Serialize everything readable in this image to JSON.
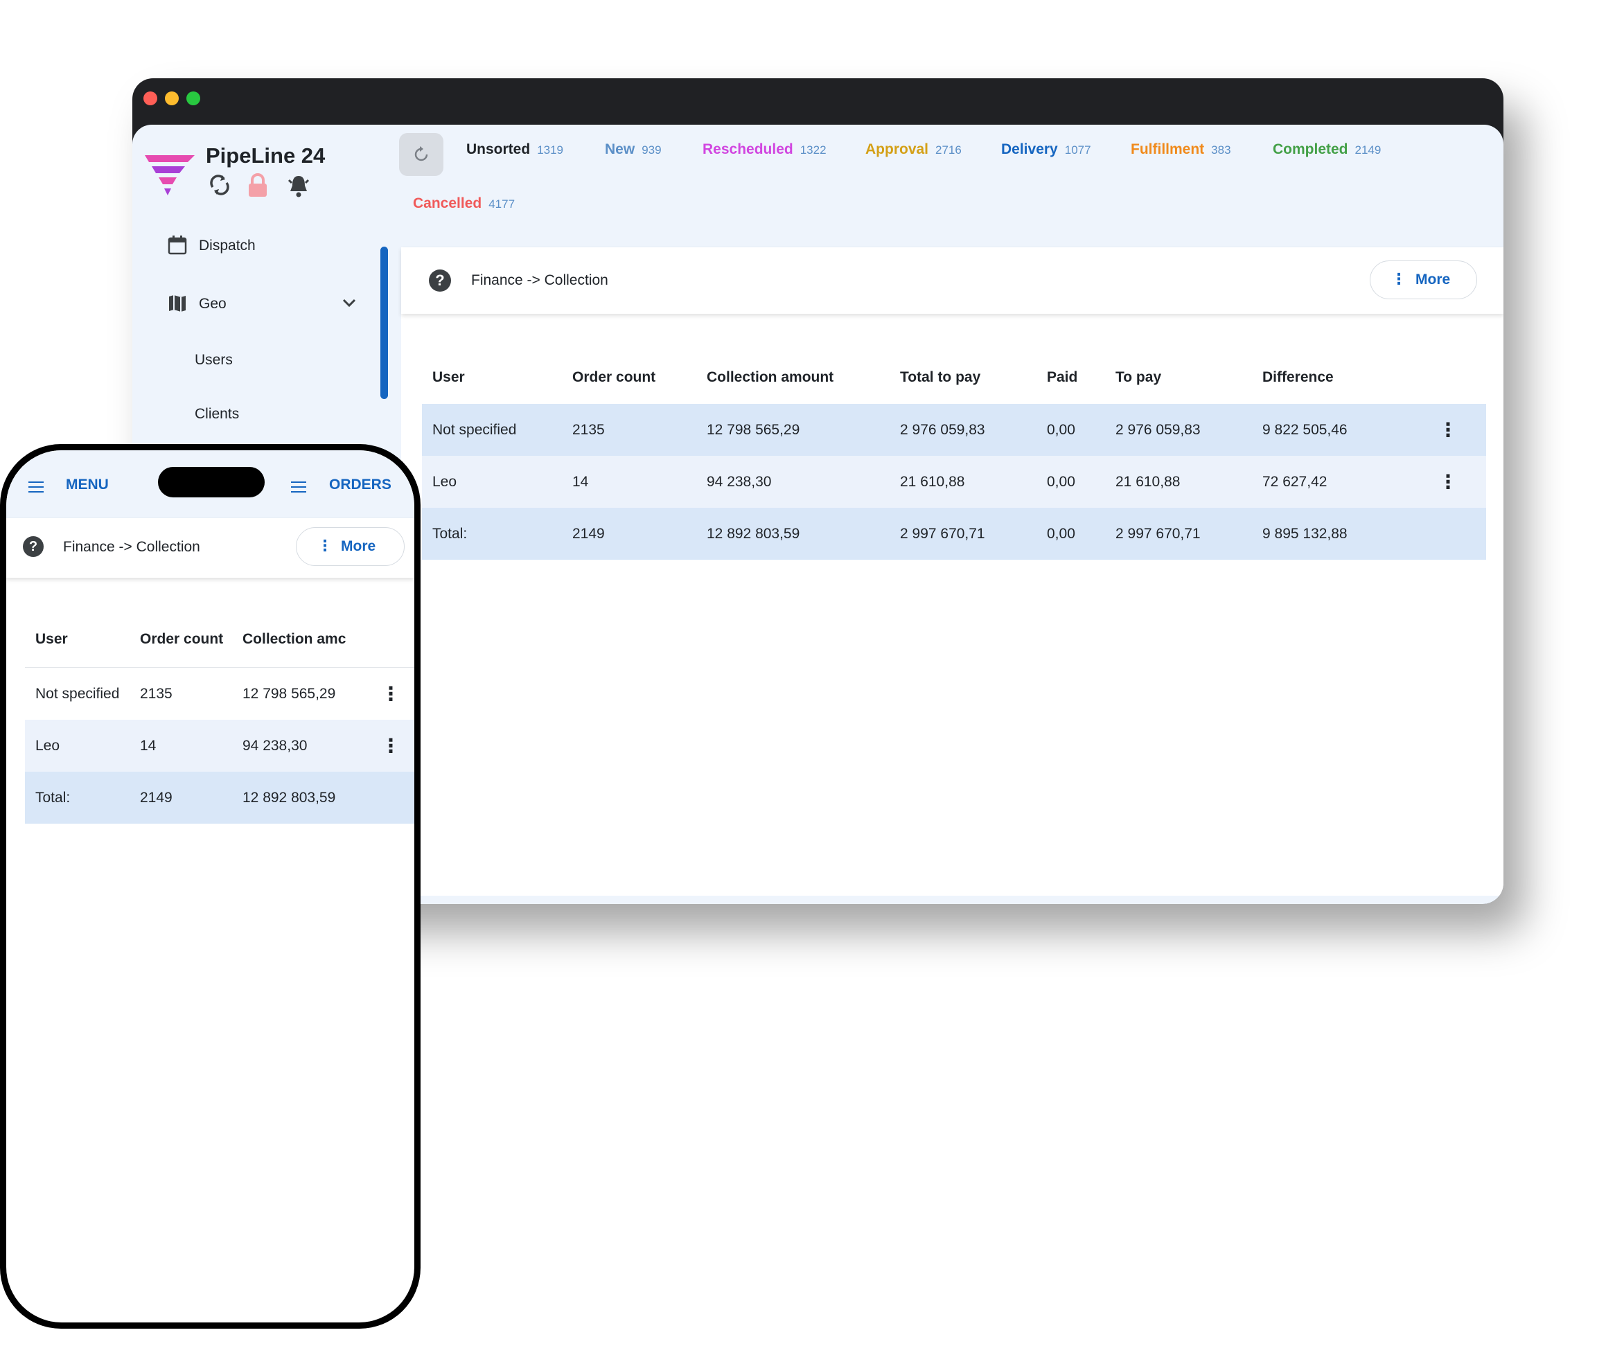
{
  "app": {
    "brand": "PipeLine 24",
    "sidebar": [
      {
        "label": "Dispatch",
        "icon": "calendar-icon"
      },
      {
        "label": "Geo",
        "icon": "map-icon"
      },
      {
        "label": "Users"
      },
      {
        "label": "Clients"
      }
    ],
    "status_chips": [
      {
        "label": "Unsorted",
        "count": "1319",
        "color": "#1f2328"
      },
      {
        "label": "New",
        "count": "939",
        "color": "#5b8fc7"
      },
      {
        "label": "Rescheduled",
        "count": "1322",
        "color": "#d146e0"
      },
      {
        "label": "Approval",
        "count": "2716",
        "color": "#d4a017"
      },
      {
        "label": "Delivery",
        "count": "1077",
        "color": "#1565c0"
      },
      {
        "label": "Fulfillment",
        "count": "383",
        "color": "#f08a1c"
      },
      {
        "label": "Completed",
        "count": "2149",
        "color": "#43a047"
      },
      {
        "label": "Cancelled",
        "count": "4177",
        "color": "#f05a5a"
      }
    ],
    "breadcrumb": "Finance -> Collection",
    "more_label": "More",
    "help_label": "?",
    "table": {
      "columns": [
        "User",
        "Order count",
        "Collection amount",
        "Total to pay",
        "Paid",
        "To pay",
        "Difference"
      ],
      "rows": [
        [
          "Not specified",
          "2135",
          "12 798 565,29",
          "2 976 059,83",
          "0,00",
          "2 976 059,83",
          "9 822 505,46"
        ],
        [
          "Leo",
          "14",
          "94 238,30",
          "21 610,88",
          "0,00",
          "21 610,88",
          "72 627,42"
        ]
      ],
      "total": [
        "Total:",
        "2149",
        "12 892 803,59",
        "2 997 670,71",
        "0,00",
        "2 997 670,71",
        "9 895 132,88"
      ]
    }
  },
  "phone": {
    "menu_label": "MENU",
    "orders_label": "ORDERS",
    "breadcrumb": "Finance -> Collection",
    "more_label": "More",
    "columns": [
      "User",
      "Order count",
      "Collection amc"
    ],
    "rows": [
      [
        "Not specified",
        "2135",
        "12 798 565,29"
      ],
      [
        "Leo",
        "14",
        "94 238,30"
      ]
    ],
    "total": [
      "Total:",
      "2149",
      "12 892 803,59"
    ]
  }
}
